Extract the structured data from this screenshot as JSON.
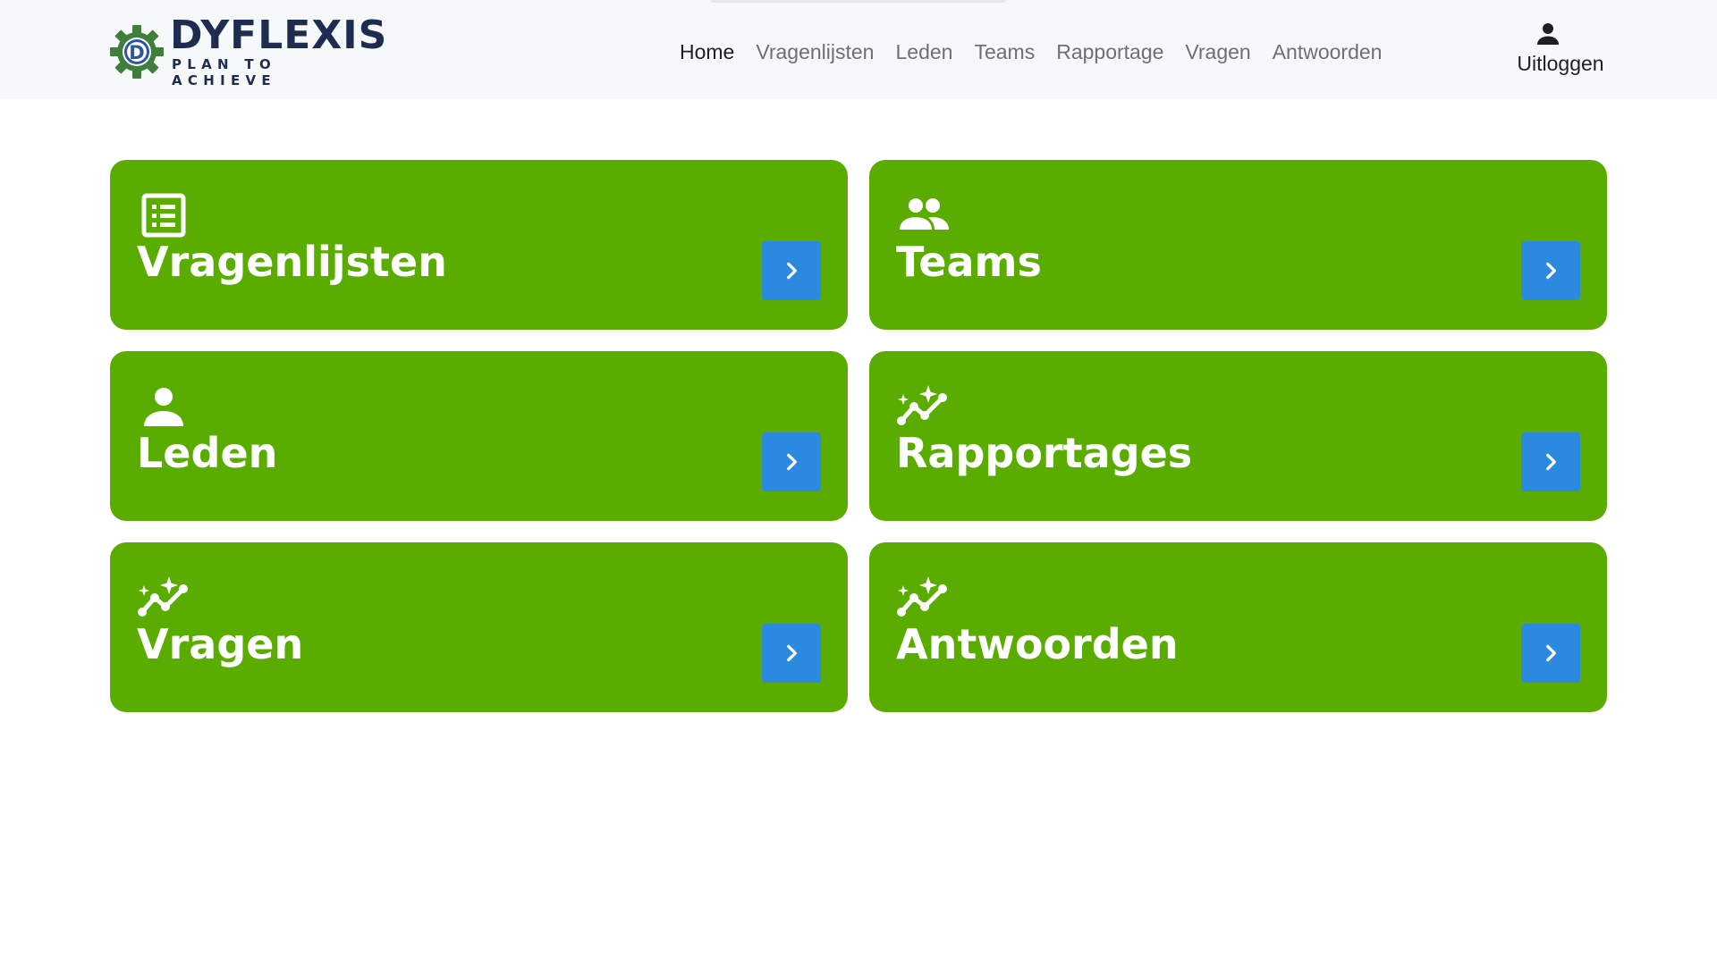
{
  "brand": {
    "name": "DYFLEXIS",
    "tagline": "PLAN TO ACHIEVE",
    "logo_letter": "D",
    "colors": {
      "text": "#1e2d4f",
      "gear": "#3f7f3b",
      "gear_center": "#2a55a7"
    }
  },
  "nav": {
    "items": [
      {
        "label": "Home",
        "active": true
      },
      {
        "label": "Vragenlijsten",
        "active": false
      },
      {
        "label": "Leden",
        "active": false
      },
      {
        "label": "Teams",
        "active": false
      },
      {
        "label": "Rapportage",
        "active": false
      },
      {
        "label": "Vragen",
        "active": false
      },
      {
        "label": "Antwoorden",
        "active": false
      }
    ]
  },
  "user": {
    "icon": "person-icon",
    "logout_label": "Uitloggen"
  },
  "cards": [
    {
      "title": "Vragenlijsten",
      "icon": "list-icon"
    },
    {
      "title": "Teams",
      "icon": "group-icon"
    },
    {
      "title": "Leden",
      "icon": "person-icon"
    },
    {
      "title": "Rapportages",
      "icon": "sparkle-chart-icon"
    },
    {
      "title": "Vragen",
      "icon": "sparkle-chart-icon"
    },
    {
      "title": "Antwoorden",
      "icon": "sparkle-chart-icon"
    }
  ],
  "colors": {
    "card_bg": "#5aad00",
    "button_bg": "#2b8ae0",
    "navbar_bg": "#f7f8fa"
  }
}
